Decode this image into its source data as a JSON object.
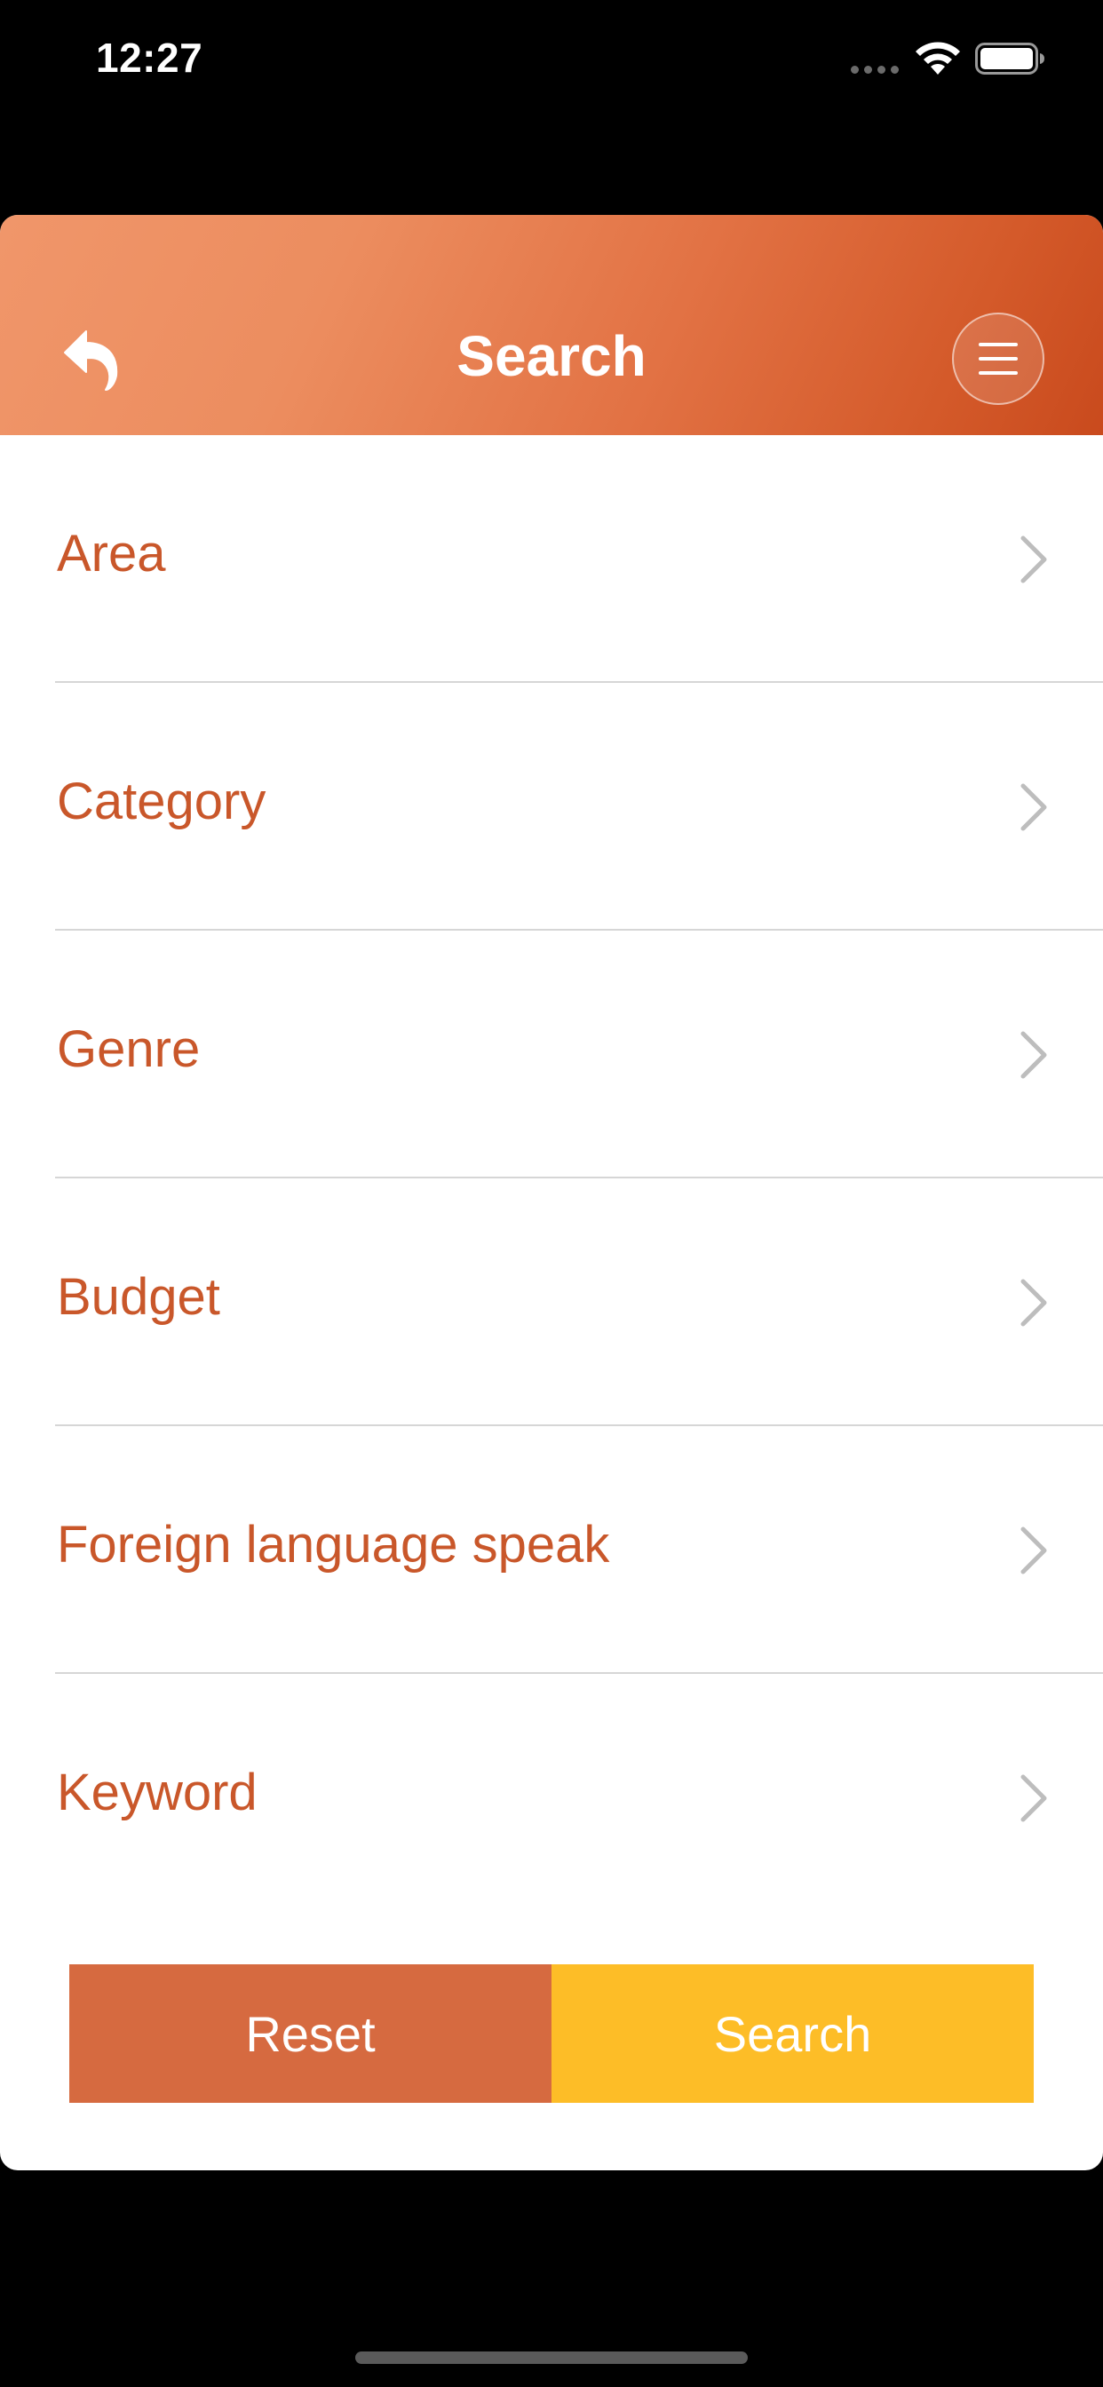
{
  "status_bar": {
    "time": "12:27"
  },
  "header": {
    "title": "Search",
    "back_icon": "back-arrow-icon",
    "menu_icon": "hamburger-menu-icon"
  },
  "filters": [
    {
      "label": "Area"
    },
    {
      "label": "Category"
    },
    {
      "label": "Genre"
    },
    {
      "label": "Budget"
    },
    {
      "label": "Foreign language speak"
    },
    {
      "label": "Keyword"
    }
  ],
  "actions": {
    "reset_label": "Reset",
    "search_label": "Search"
  },
  "colors": {
    "accent_text": "#c9572a",
    "reset_button": "#d66a40",
    "search_button": "#fdbd27",
    "header_gradient_start": "#f0966a",
    "header_gradient_end": "#c94a1d"
  }
}
